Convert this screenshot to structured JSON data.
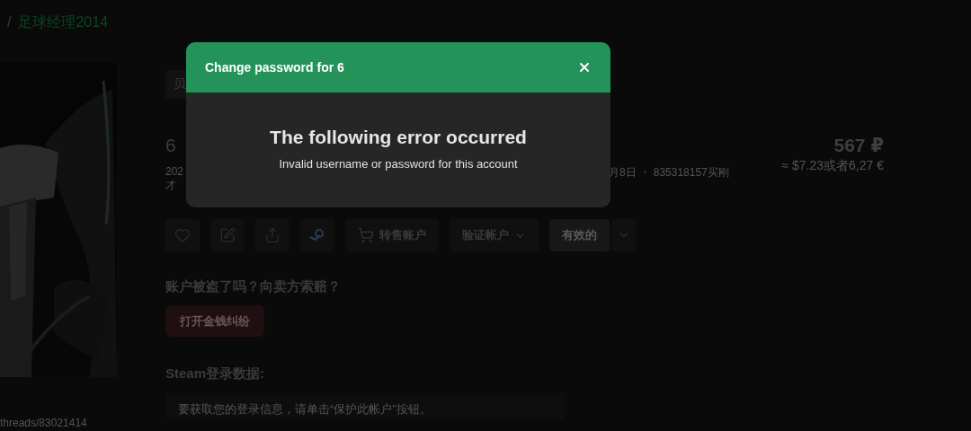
{
  "breadcrumb": {
    "separator": "/",
    "current": "足球经理2014"
  },
  "link_fragment": "threads/83021414",
  "tab_fragment": "贝",
  "title": "6",
  "meta": {
    "left_fragments": [
      "202",
      "才"
    ],
    "date_fragment": "月8日",
    "seller": "835318157买刚"
  },
  "price": {
    "main": "567 ₽",
    "converted": "≈ $7.23或者6,27 €"
  },
  "actions": [
    {
      "kind": "favorite"
    },
    {
      "kind": "edit"
    },
    {
      "kind": "share"
    },
    {
      "kind": "steam"
    },
    {
      "kind": "resell",
      "label": "转售账户"
    },
    {
      "kind": "dropdown",
      "label": "验证帐户"
    },
    {
      "kind": "status",
      "label": "有效的"
    }
  ],
  "dispute": {
    "question": "账户被盗了吗？向卖方索赔？",
    "button": "打开金钱纠纷"
  },
  "steam_login": {
    "heading": "Steam登录数据:",
    "hint": "要获取您的登录信息，请单击“保护此帐户”按钮。"
  },
  "modal": {
    "title": "Change password for 6",
    "error_title": "The following error occurred",
    "error_message": "Invalid username or password for this account"
  }
}
